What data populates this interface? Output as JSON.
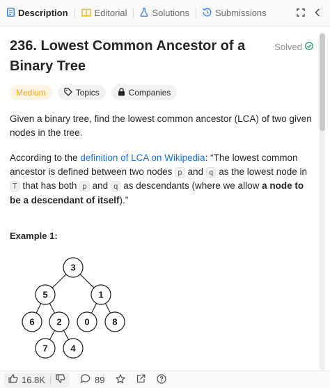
{
  "tabs": [
    {
      "label": "Description",
      "icon": "description-icon"
    },
    {
      "label": "Editorial",
      "icon": "book-icon"
    },
    {
      "label": "Solutions",
      "icon": "flask-icon"
    },
    {
      "label": "Submissions",
      "icon": "history-icon"
    }
  ],
  "problem": {
    "title": "236. Lowest Common Ancestor of a Binary Tree",
    "status": "Solved",
    "difficulty": "Medium",
    "topics_label": "Topics",
    "companies_label": "Companies"
  },
  "description": {
    "p1": "Given a binary tree, find the lowest common ancestor (LCA) of two given nodes in the tree.",
    "p2_intro": "According to the ",
    "p2_link": "definition of LCA on Wikipedia",
    "p2_a": ": “The lowest common ancestor is defined between two nodes ",
    "code_p": "p",
    "p2_b": " and ",
    "code_q": "q",
    "p2_c": " as the lowest node in ",
    "code_T": "T",
    "p2_d": " that has both ",
    "p2_e": " and ",
    "p2_f": " as descendants (where we allow ",
    "p2_bold": "a node to be a descendant of itself",
    "p2_g": ").”"
  },
  "example": {
    "title": "Example 1:",
    "tree_nodes": [
      "3",
      "5",
      "1",
      "6",
      "2",
      "0",
      "8",
      "7",
      "4"
    ]
  },
  "footer": {
    "likes": "16.8K",
    "comments": "89"
  }
}
